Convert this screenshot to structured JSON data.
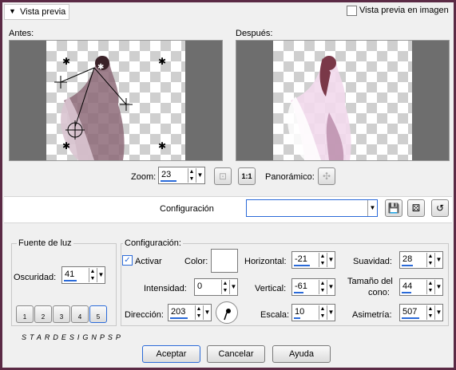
{
  "header": {
    "toggle_label": "Vista previa",
    "preview_in_image_label": "Vista previa en imagen"
  },
  "preview": {
    "before_label": "Antes:",
    "after_label": "Después:"
  },
  "zoom": {
    "label": "Zoom:",
    "value": "23",
    "panoramic_label": "Panorámico:",
    "actual_size_icon": "1:1"
  },
  "settings_bar": {
    "label": "Configuración",
    "value": ""
  },
  "light_source": {
    "title": "Fuente de luz",
    "darkness_label": "Oscuridad:",
    "darkness_value": "41",
    "presets": [
      "1",
      "2",
      "3",
      "4",
      "5"
    ]
  },
  "config": {
    "title": "Configuración:",
    "activate_label": "Activar",
    "color_label": "Color:",
    "color_value": "#ffffff",
    "intensity_label": "Intensidad:",
    "intensity_value": "0",
    "direction_label": "Dirección:",
    "direction_value": "203",
    "horizontal_label": "Horizontal:",
    "horizontal_value": "-21",
    "vertical_label": "Vertical:",
    "vertical_value": "-61",
    "scale_label": "Escala:",
    "scale_value": "10",
    "smoothness_label": "Suavidad:",
    "smoothness_value": "28",
    "cone_label_1": "Tamaño del",
    "cone_label_2": "cono:",
    "cone_value": "44",
    "asymmetry_label": "Asimetría:",
    "asymmetry_value": "507"
  },
  "watermark": "STARDESIGNPSP",
  "footer": {
    "accept": "Aceptar",
    "cancel": "Cancelar",
    "help": "Ayuda"
  },
  "colors": {
    "accent": "#2a6ad8",
    "border": "#5b2a45"
  }
}
